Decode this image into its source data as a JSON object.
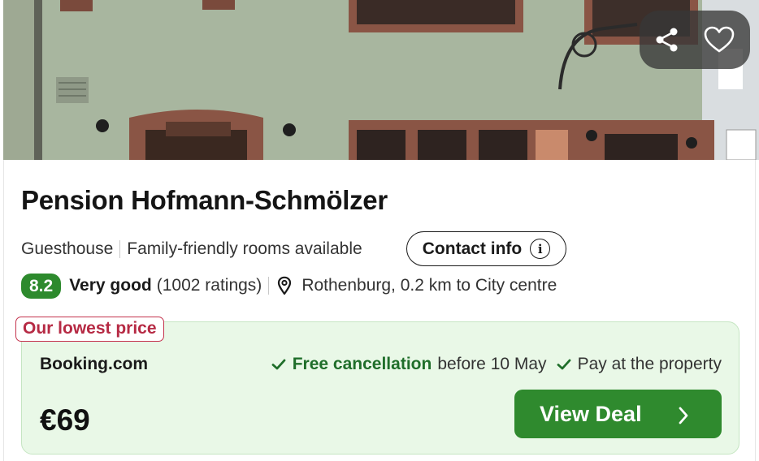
{
  "hotel": {
    "name": "Pension Hofmann-Schmölzer",
    "type": "Guesthouse",
    "feature": "Family-friendly rooms available",
    "contact_label": "Contact info",
    "contact_icon": "info-icon",
    "score": "8.2",
    "score_color": "#2d8a2d",
    "verdict": "Very good",
    "ratings": "(1002 ratings)",
    "location": "Rothenburg, 0.2 km to City centre"
  },
  "photo_actions": {
    "share_icon": "share-icon",
    "favorite_icon": "heart-icon"
  },
  "deal": {
    "tag": "Our lowest price",
    "tag_color": "#b62a44",
    "provider": "Booking.com",
    "perk_1_strong": "Free cancellation",
    "perk_1_rest": "before 10 May",
    "perk_2": "Pay at the property",
    "price": "€69",
    "button_label": "View Deal",
    "button_color": "#2f8a2e",
    "box_color": "#e9f8e7"
  }
}
